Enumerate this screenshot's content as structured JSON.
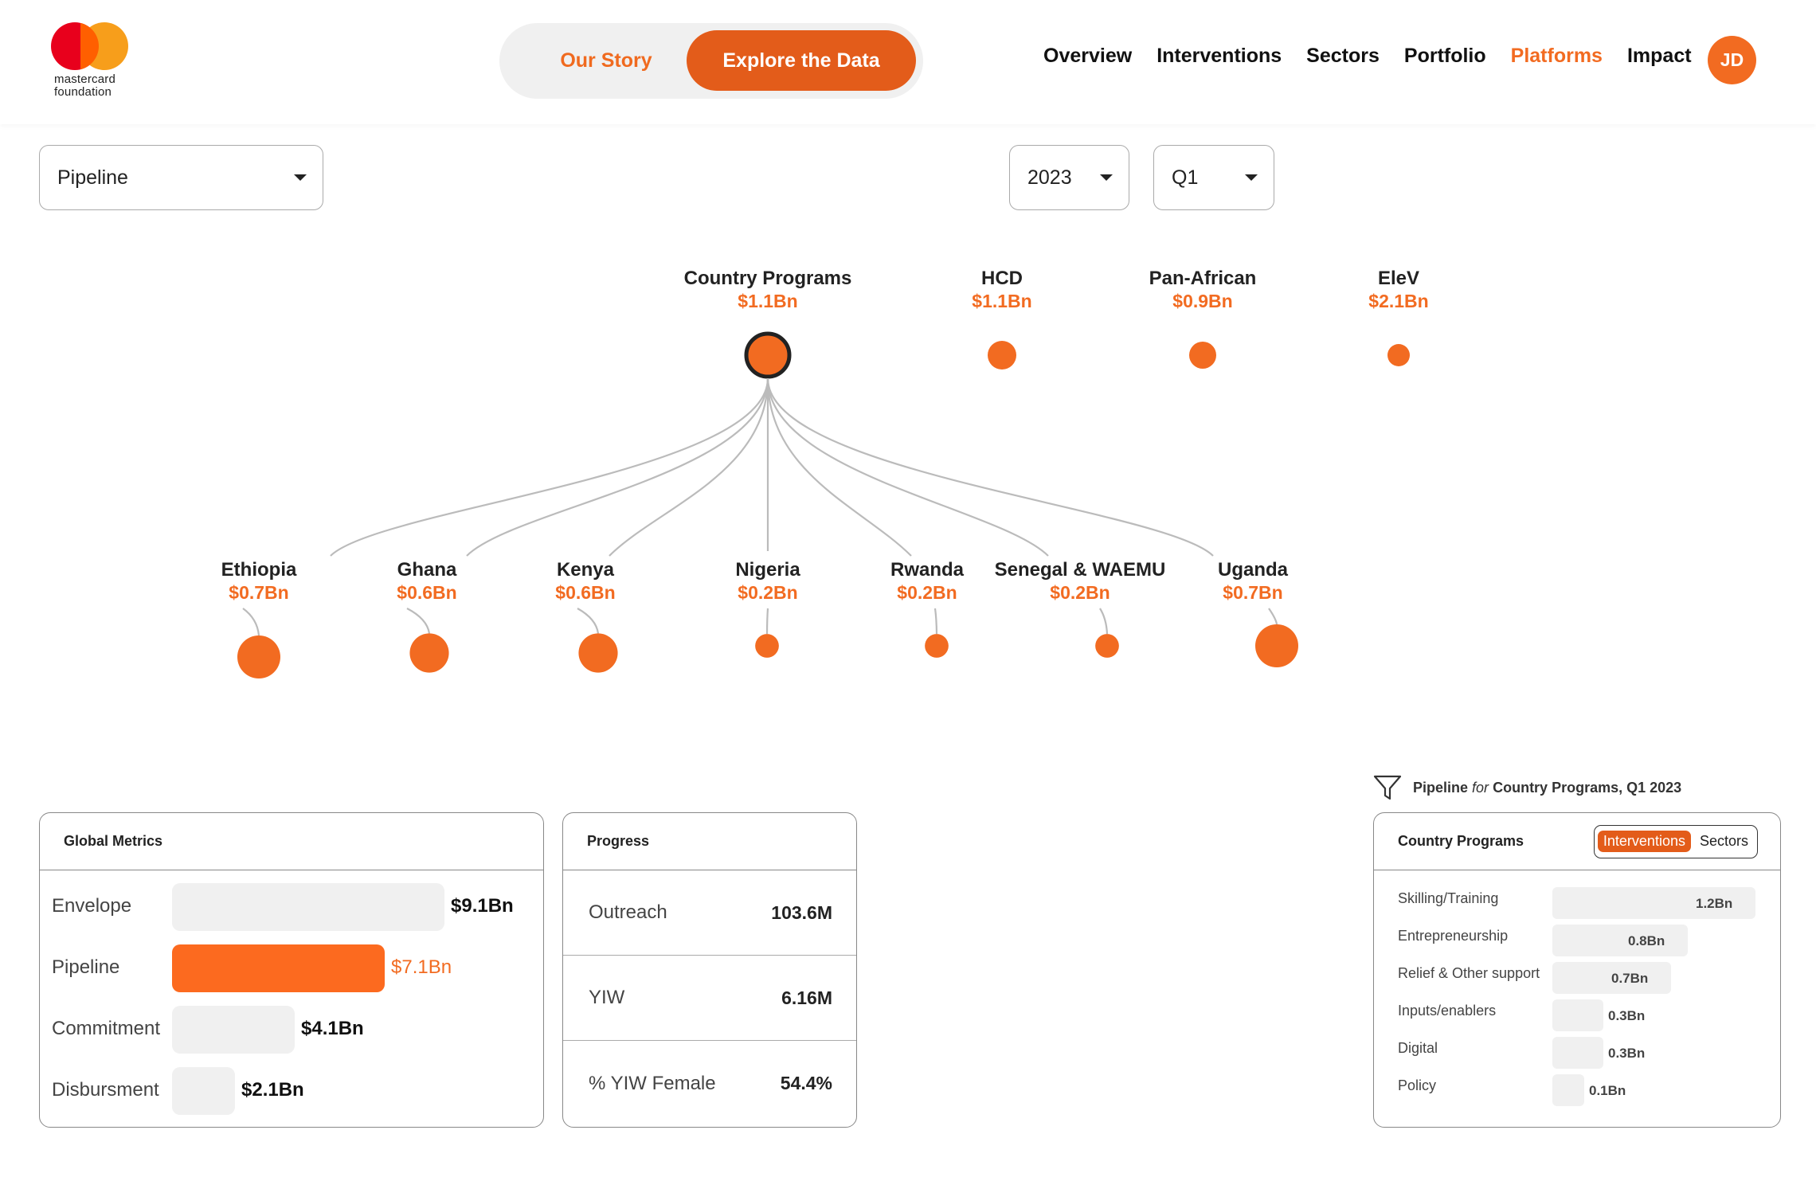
{
  "brand": {
    "line1": "mastercard",
    "line2": "foundation"
  },
  "story_toggle": {
    "options": [
      "Our Story",
      "Explore the Data"
    ],
    "active": "Explore the Data"
  },
  "nav": {
    "items": [
      "Overview",
      "Interventions",
      "Sectors",
      "Portfolio",
      "Platforms",
      "Impact"
    ],
    "active": "Platforms"
  },
  "user": {
    "initials": "JD"
  },
  "colors": {
    "accent": "#f26b21",
    "accent_dark": "#e35c1a",
    "bar_bg": "#f0f0f0",
    "link": "#bbbbbb"
  },
  "filters": {
    "metric": "Pipeline",
    "year": "2023",
    "quarter": "Q1"
  },
  "tree": {
    "platforms": [
      {
        "name": "Country Programs",
        "amount": "$1.1Bn",
        "selected": true
      },
      {
        "name": "HCD",
        "amount": "$1.1Bn",
        "selected": false
      },
      {
        "name": "Pan-African",
        "amount": "$0.9Bn",
        "selected": false
      },
      {
        "name": "EleV",
        "amount": "$2.1Bn",
        "selected": false
      }
    ],
    "countries": [
      {
        "name": "Ethiopia",
        "amount": "$0.7Bn",
        "value": 0.7
      },
      {
        "name": "Ghana",
        "amount": "$0.6Bn",
        "value": 0.6
      },
      {
        "name": "Kenya",
        "amount": "$0.6Bn",
        "value": 0.6
      },
      {
        "name": "Nigeria",
        "amount": "$0.2Bn",
        "value": 0.2
      },
      {
        "name": "Rwanda",
        "amount": "$0.2Bn",
        "value": 0.2
      },
      {
        "name": "Senegal & WAEMU",
        "amount": "$0.2Bn",
        "value": 0.2
      },
      {
        "name": "Uganda",
        "amount": "$0.7Bn",
        "value": 0.7
      }
    ]
  },
  "global_metrics": {
    "title": "Global Metrics",
    "rows": [
      {
        "label": "Envelope",
        "value": "$9.1Bn",
        "amount": 9.1,
        "highlight": false
      },
      {
        "label": "Pipeline",
        "value": "$7.1Bn",
        "amount": 7.1,
        "highlight": true
      },
      {
        "label": "Commitment",
        "value": "$4.1Bn",
        "amount": 4.1,
        "highlight": false
      },
      {
        "label": "Disbursment",
        "value": "$2.1Bn",
        "amount": 2.1,
        "highlight": false
      }
    ]
  },
  "progress": {
    "title": "Progress",
    "rows": [
      {
        "label": "Outreach",
        "value": "103.6M"
      },
      {
        "label": "YIW",
        "value": "6.16M"
      },
      {
        "label": "% YIW Female",
        "value": "54.4%"
      }
    ]
  },
  "filter_caption": {
    "metric": "Pipeline",
    "for": "for",
    "scope": "Country Programs, Q1 2023"
  },
  "country_programs": {
    "title": "Country Programs",
    "tabs": [
      "Interventions",
      "Sectors"
    ],
    "active_tab": "Interventions",
    "rows": [
      {
        "label": "Skilling/Training",
        "value": "1.2Bn",
        "amount": 1.2
      },
      {
        "label": "Entrepreneurship",
        "value": "0.8Bn",
        "amount": 0.8
      },
      {
        "label": "Relief & Other support",
        "value": "0.7Bn",
        "amount": 0.7
      },
      {
        "label": "Inputs/enablers",
        "value": "0.3Bn",
        "amount": 0.3
      },
      {
        "label": "Digital",
        "value": "0.3Bn",
        "amount": 0.3
      },
      {
        "label": "Policy",
        "value": "0.1Bn",
        "amount": 0.1
      }
    ]
  }
}
